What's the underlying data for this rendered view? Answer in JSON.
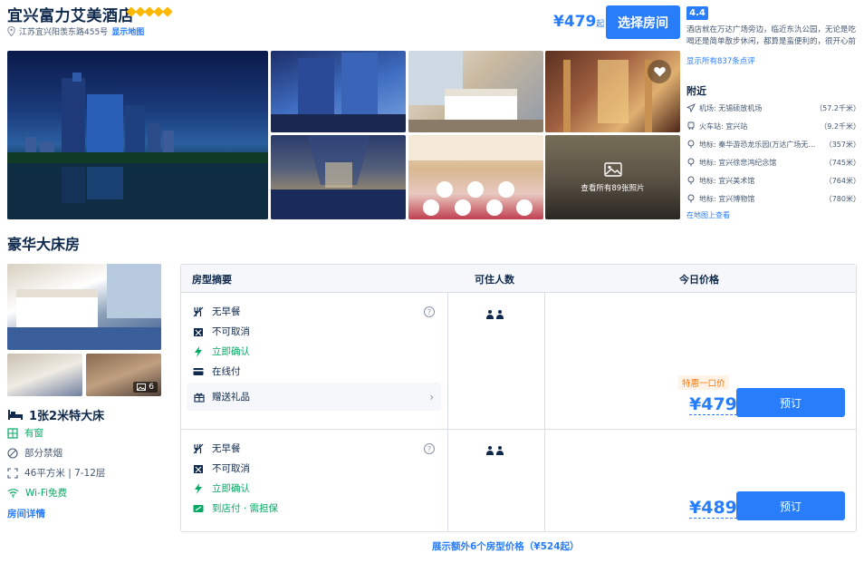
{
  "hotel": {
    "name": "宜兴富力艾美酒店",
    "address": "江苏宜兴阳羡东路455号",
    "map_link": "显示地图",
    "price_from": "¥479",
    "price_suffix": "起",
    "select_room": "选择房间",
    "score": "4.4",
    "review_snippet": "酒店就在万达广场旁边，临近东氿公园，无论是吃喝还是简单散步休闲，都算是蛮便利的，很开心前台...",
    "review_link": "显示所有837条点评"
  },
  "gallery": {
    "all_photos": "查看所有89张照片"
  },
  "nearby": {
    "title": "附近",
    "items": [
      {
        "icon": "plane-icon",
        "text": "机场: 无锡硕放机场",
        "dist": "（57.2千米）"
      },
      {
        "icon": "train-icon",
        "text": "火车站: 宜兴站",
        "dist": "（9.2千米）"
      },
      {
        "icon": "pin-icon",
        "text": "地标: 秦华游恐龙乐园(万达广场无锡宜...",
        "dist": "（357米）"
      },
      {
        "icon": "pin-icon",
        "text": "地标: 宜兴徐悲鸿纪念馆",
        "dist": "（745米）"
      },
      {
        "icon": "pin-icon",
        "text": "地标: 宜兴美术馆",
        "dist": "（764米）"
      },
      {
        "icon": "pin-icon",
        "text": "地标: 宜兴博物馆",
        "dist": "（780米）"
      }
    ],
    "map_link": "在地图上查看"
  },
  "room": {
    "title": "豪华大床房",
    "image_count": "6",
    "bed": "1张2米特大床",
    "features": [
      {
        "icon": "window-icon",
        "text": "有窗",
        "green": true
      },
      {
        "icon": "no-smoking-icon",
        "text": "部分禁烟",
        "green": false
      },
      {
        "icon": "area-icon",
        "text": "46平方米 | 7-12层",
        "green": false
      },
      {
        "icon": "wifi-icon",
        "text": "Wi-Fi免费",
        "green": true
      }
    ],
    "details_link": "房间详情"
  },
  "table": {
    "col_summary": "房型摘要",
    "col_guests": "可住人数",
    "col_price": "今日价格",
    "rows": [
      {
        "policies": [
          {
            "icon": "no-breakfast-icon",
            "text": "无早餐",
            "green": false
          },
          {
            "icon": "no-cancel-icon",
            "text": "不可取消",
            "green": false
          },
          {
            "icon": "lightning-icon",
            "text": "立即确认",
            "green": true
          },
          {
            "icon": "card-icon",
            "text": "在线付",
            "green": false
          }
        ],
        "gift": "赠送礼品",
        "promo": "特惠一口价",
        "price": "¥479",
        "book": "预订"
      },
      {
        "policies": [
          {
            "icon": "no-breakfast-icon",
            "text": "无早餐",
            "green": false
          },
          {
            "icon": "no-cancel-icon",
            "text": "不可取消",
            "green": false
          },
          {
            "icon": "lightning-icon",
            "text": "立即确认",
            "green": true
          },
          {
            "icon": "pay-at-hotel-icon",
            "text": "到店付 · 需担保",
            "green": true
          }
        ],
        "price": "¥489",
        "book": "预订"
      }
    ],
    "more_rooms": "展示额外6个房型价格（¥524起）"
  },
  "colors": {
    "brand": "#287dfa",
    "star": "#ffb800",
    "green": "#06a964",
    "promo": "#ff7700"
  }
}
